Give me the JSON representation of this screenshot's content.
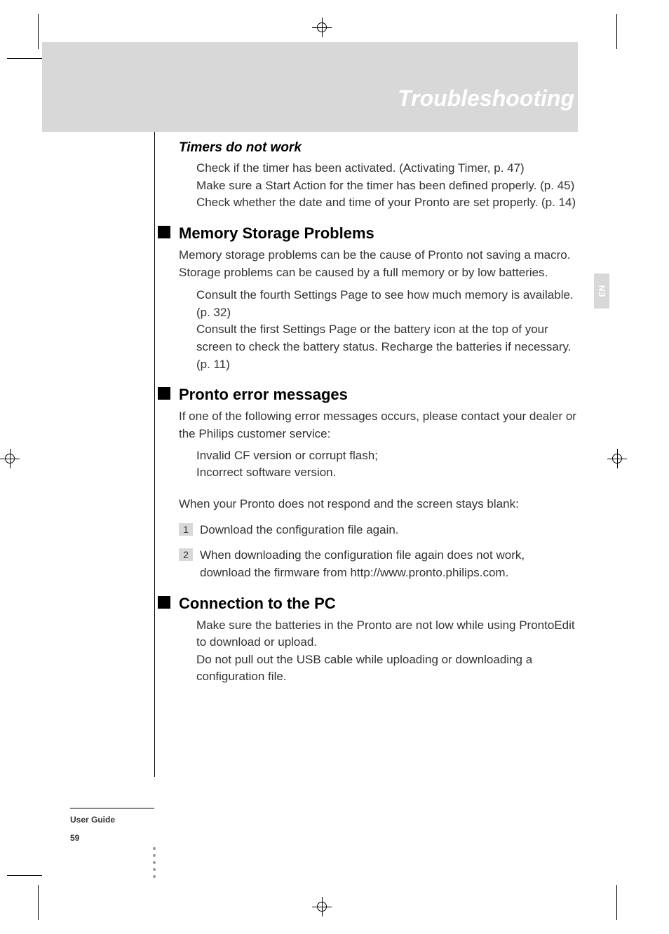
{
  "page": {
    "title": "Troubleshooting",
    "footer_label": "User Guide",
    "page_number": "59",
    "lang": "EN"
  },
  "sections": {
    "timers": {
      "heading": "Timers do not work",
      "line1": "Check if the timer has been activated. (Activating Timer, p. 47)",
      "line2": "Make sure a Start Action for the timer has been defined properly. (p. 45)",
      "line3": "Check whether the date and time of your Pronto are set properly. (p. 14)"
    },
    "memory": {
      "heading": "Memory Storage Problems",
      "intro": "Memory storage problems can be the cause of Pronto not saving a macro. Storage problems can be caused by a full memory or by low batteries.",
      "line1": "Consult the fourth Settings Page to see how much memory is available. (p. 32)",
      "line2": "Consult the first Settings Page or the battery icon at the top of your screen to check the battery status. Recharge the batteries if necessary. (p. 11)"
    },
    "errors": {
      "heading": "Pronto error messages",
      "intro": "If one of the following error messages occurs, please contact your dealer or the Philips customer service:",
      "line1": "Invalid CF version or corrupt flash;",
      "line2": "Incorrect software version.",
      "blank_intro": "When your Pronto does not respond and the screen stays blank:",
      "step1": "Download the configuration file again.",
      "step2": "When downloading the configuration file again does not work, download the firmware from http://www.pronto.philips.com."
    },
    "connection": {
      "heading": "Connection to the PC",
      "line1": "Make sure the batteries in the Pronto are not low while using ProntoEdit to download or upload.",
      "line2": "Do not pull out the USB cable while uploading or downloading a configuration file."
    }
  }
}
